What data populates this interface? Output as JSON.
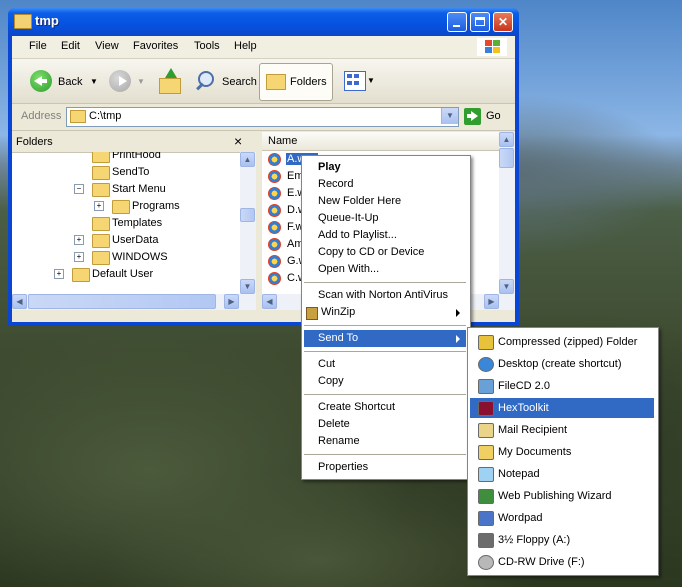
{
  "window": {
    "title": "tmp"
  },
  "menubar": [
    "File",
    "Edit",
    "View",
    "Favorites",
    "Tools",
    "Help"
  ],
  "toolbar": {
    "back_label": "Back",
    "search_label": "Search",
    "folders_label": "Folders"
  },
  "addressbar": {
    "label": "Address",
    "value": "C:\\tmp",
    "go_label": "Go"
  },
  "folders_pane": {
    "header": "Folders",
    "close_glyph": "×",
    "tree": [
      {
        "label": "PrintHood",
        "indent": 2,
        "expander": ""
      },
      {
        "label": "SendTo",
        "indent": 2,
        "expander": ""
      },
      {
        "label": "Start Menu",
        "indent": 2,
        "expander": "−"
      },
      {
        "label": "Programs",
        "indent": 3,
        "expander": "+"
      },
      {
        "label": "Templates",
        "indent": 2,
        "expander": ""
      },
      {
        "label": "UserData",
        "indent": 2,
        "expander": "+"
      },
      {
        "label": "WINDOWS",
        "indent": 2,
        "expander": "+"
      },
      {
        "label": "Default User",
        "indent": 1,
        "expander": "+"
      }
    ]
  },
  "files_pane": {
    "column_header": "Name",
    "files": [
      "A.wav",
      "Em.wav",
      "E.wav",
      "D.wav",
      "F.wav",
      "Am.wav",
      "G.wav",
      "C.wav"
    ]
  },
  "context_menu": {
    "groups": [
      [
        "Play",
        "Record",
        "New Folder Here",
        "Queue-It-Up",
        "Add to Playlist...",
        "Copy to CD or Device",
        "Open With..."
      ],
      [
        "Scan with Norton AntiVirus",
        "WinZip"
      ],
      [
        "Send To"
      ],
      [
        "Cut",
        "Copy"
      ],
      [
        "Create Shortcut",
        "Delete",
        "Rename"
      ],
      [
        "Properties"
      ]
    ],
    "default_item": "Play",
    "highlighted_item": "Send To"
  },
  "sendto_menu": {
    "items": [
      {
        "label": "Compressed (zipped) Folder",
        "icon": "zip-folder-icon",
        "color": "#e8c23a"
      },
      {
        "label": "Desktop (create shortcut)",
        "icon": "desktop-icon",
        "color": "#3a86d8"
      },
      {
        "label": "FileCD 2.0",
        "icon": "filecd-icon",
        "color": "#6aa0d8"
      },
      {
        "label": "HexToolkit",
        "icon": "hextoolkit-icon",
        "color": "#8a1030"
      },
      {
        "label": "Mail Recipient",
        "icon": "mail-icon",
        "color": "#e9d48a"
      },
      {
        "label": "My Documents",
        "icon": "my-documents-icon",
        "color": "#f0cf63"
      },
      {
        "label": "Notepad",
        "icon": "notepad-icon",
        "color": "#9fd1f2"
      },
      {
        "label": "Web Publishing Wizard",
        "icon": "web-publishing-icon",
        "color": "#3e8e3e"
      },
      {
        "label": "Wordpad",
        "icon": "wordpad-icon",
        "color": "#4a74c8"
      },
      {
        "label": "3½ Floppy (A:)",
        "icon": "floppy-icon",
        "color": "#6c6c6c"
      },
      {
        "label": "CD-RW Drive (F:)",
        "icon": "cd-drive-icon",
        "color": "#b8b8b8"
      }
    ],
    "highlighted_item": "HexToolkit"
  }
}
